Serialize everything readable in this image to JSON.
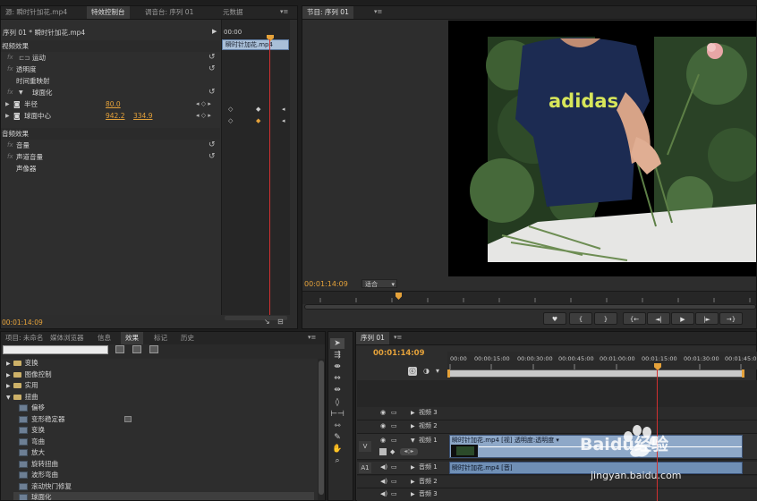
{
  "effect_controls_panel": {
    "tabs": [
      "源: 瞬时针加花.mp4",
      "特效控制台",
      "调音台: 序列 01",
      "元数据"
    ],
    "sequence_label": "序列 01 * 瞬时针加花.mp4",
    "timecode_start": "00:00",
    "clip_name": "瞬时针加花.mp4",
    "section_video": "视频效果",
    "section_audio": "音频效果",
    "rows": [
      {
        "label": "运动"
      },
      {
        "label": "透明度"
      },
      {
        "label": "时间重映射"
      },
      {
        "label": "球面化"
      }
    ],
    "params": [
      {
        "label": "半径",
        "value": "80.0"
      },
      {
        "label": "球面中心",
        "value_x": "942.2",
        "value_y": "334.9"
      }
    ],
    "audio_rows": [
      {
        "label": "音量"
      },
      {
        "label": "声道音量"
      },
      {
        "label": "声像器"
      }
    ],
    "current_time": "00:01:14:09"
  },
  "program_monitor": {
    "tab": "节目: 序列 01",
    "timecode": "00:01:14:09",
    "fit_label": "适合",
    "transport_buttons": [
      "♥",
      "{",
      "}",
      "{←",
      "◄|",
      "▶",
      "|►",
      "→}"
    ],
    "shirt_text": "adidas"
  },
  "project_panel": {
    "tabs": [
      "项目: 未命名",
      "媒体浏览器",
      "信息",
      "效果",
      "标记",
      "历史"
    ],
    "search_placeholder": "",
    "tree": [
      {
        "label": "变换",
        "type": "folder",
        "depth": 0
      },
      {
        "label": "图像控制",
        "type": "folder",
        "depth": 0
      },
      {
        "label": "实用",
        "type": "folder",
        "depth": 0
      },
      {
        "label": "扭曲",
        "type": "folder",
        "depth": 0
      },
      {
        "label": "偏移",
        "type": "effect",
        "depth": 1
      },
      {
        "label": "变形稳定器",
        "type": "effect",
        "depth": 1
      },
      {
        "label": "变换",
        "type": "effect",
        "depth": 1
      },
      {
        "label": "弯曲",
        "type": "effect",
        "depth": 1
      },
      {
        "label": "放大",
        "type": "effect",
        "depth": 1
      },
      {
        "label": "旋转扭曲",
        "type": "effect",
        "depth": 1
      },
      {
        "label": "波形弯曲",
        "type": "effect",
        "depth": 1
      },
      {
        "label": "滚动快门修复",
        "type": "effect",
        "depth": 1
      },
      {
        "label": "球面化",
        "type": "effect",
        "depth": 1
      }
    ]
  },
  "timeline": {
    "tab": "序列 01",
    "timecode": "00:01:14:09",
    "ruler": [
      "00:00",
      "00:00:15:00",
      "00:00:30:00",
      "00:00:45:00",
      "00:01:00:00",
      "00:01:15:00",
      "00:01:30:00",
      "00:01:45:00"
    ],
    "tracks": [
      {
        "name": "视频 3",
        "kind": "video"
      },
      {
        "name": "视频 2",
        "kind": "video"
      },
      {
        "name": "视频 1",
        "kind": "video",
        "source_label": "V"
      },
      {
        "name": "音频 1",
        "kind": "audio",
        "source_label": "A1"
      },
      {
        "name": "音频 2",
        "kind": "audio"
      },
      {
        "name": "音频 3",
        "kind": "audio"
      }
    ],
    "video_clip_label": "瞬时针加花.mp4 [视] 透明度:透明度 ▾",
    "audio_clip_label": "瞬时针加花.mp4 [音]"
  },
  "watermark": {
    "brand": "Baidu经验",
    "url": "jingyan.baidu.com"
  },
  "colors": {
    "accent": "#e5a23a",
    "playhead": "#d03030",
    "clip_video": "#8ea8c8",
    "clip_audio": "#6f8fb5"
  }
}
